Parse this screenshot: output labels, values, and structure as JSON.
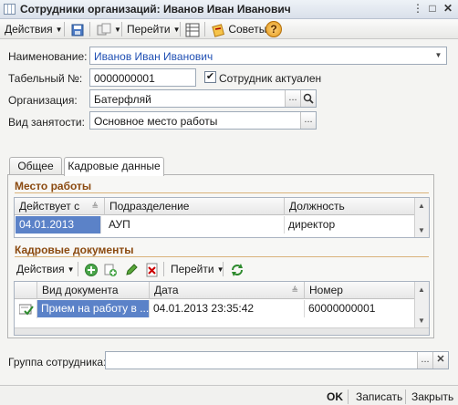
{
  "window": {
    "title": "Сотрудники организаций: Иванов Иван Иванович"
  },
  "toolbar": {
    "actions": "Действия",
    "goto": "Перейти",
    "tips": "Советы",
    "help": "?"
  },
  "form": {
    "name_label": "Наименование:",
    "name_value": "Иванов Иван Иванович",
    "tab_label": "Табельный №:",
    "tab_value": "0000000001",
    "actual_label": "Сотрудник актуален",
    "actual_checked": true,
    "org_label": "Организация:",
    "org_value": "Батерфляй",
    "employment_label": "Вид занятости:",
    "employment_value": "Основное место работы",
    "group_label": "Группа сотрудника:",
    "group_value": ""
  },
  "tabs": [
    {
      "label": "Общее",
      "active": false
    },
    {
      "label": "Кадровые данные",
      "active": true
    }
  ],
  "workplace": {
    "title": "Место работы",
    "columns": [
      "Действует с",
      "Подразделение",
      "Должность"
    ],
    "rows": [
      {
        "date": "04.01.2013",
        "department": "АУП",
        "position": "директор"
      }
    ]
  },
  "docs": {
    "title": "Кадровые документы",
    "toolbar": {
      "actions": "Действия",
      "goto": "Перейти"
    },
    "columns": [
      "Вид документа",
      "Дата",
      "Номер"
    ],
    "rows": [
      {
        "type": "Прием на работу в ...",
        "date": "04.01.2013 23:35:42",
        "number": "60000000001"
      }
    ]
  },
  "bottom": {
    "ok": "OK",
    "save": "Записать",
    "close": "Закрыть"
  },
  "colors": {
    "accent_section": "#8b4a10",
    "selection": "#5b82c8",
    "link_value": "#1f4fb3"
  }
}
